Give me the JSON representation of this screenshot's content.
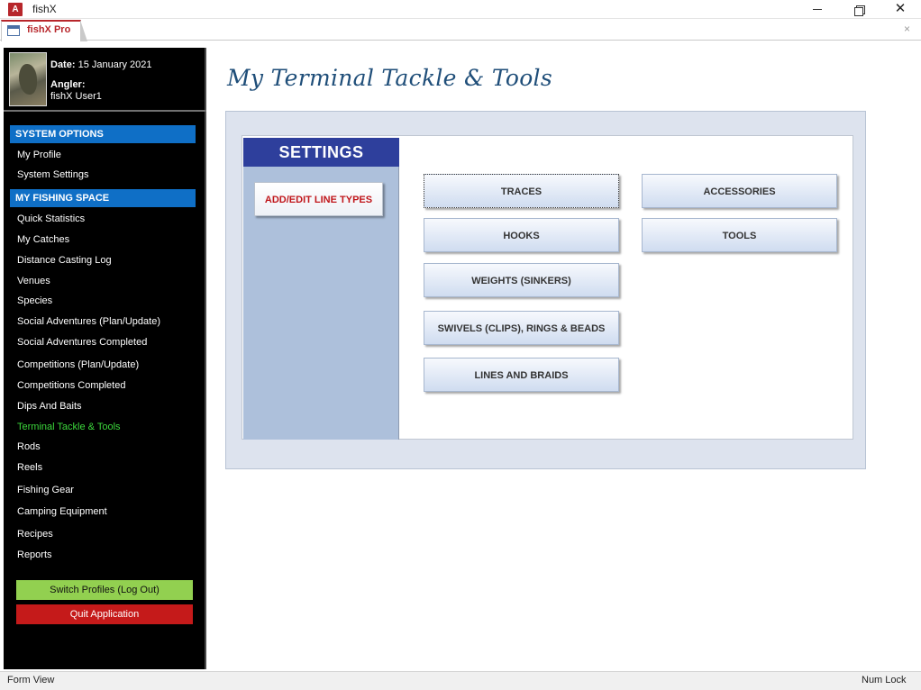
{
  "window": {
    "app_icon": "A",
    "title": "fishX",
    "min_label": "",
    "max_label": "",
    "close_label": "✕"
  },
  "tab": {
    "label": "fishX Pro",
    "close": "×"
  },
  "profile": {
    "date_label": "Date:",
    "date_value": "15 January 2021",
    "angler_label": "Angler:",
    "user": "fishX User1"
  },
  "sidebar": {
    "system_header": "SYSTEM OPTIONS",
    "system_items": [
      "My Profile",
      "System Settings"
    ],
    "fishing_header": "MY FISHING SPACE",
    "fishing_items": [
      "Quick Statistics",
      "My Catches",
      "Distance Casting Log",
      "Venues",
      "Species",
      "Social Adventures (Plan/Update)",
      "Social Adventures Completed",
      "Competitions (Plan/Update)",
      "Competitions Completed",
      "Dips And Baits",
      "Terminal Tackle & Tools",
      "Rods",
      "Reels",
      "Fishing Gear",
      "Camping Equipment",
      "Recipes",
      "Reports"
    ],
    "switch_label": "Switch Profiles (Log Out)",
    "quit_label": "Quit Application"
  },
  "main": {
    "title": "My Terminal Tackle & Tools",
    "settings_header": "SETTINGS",
    "add_line_label": "ADD/EDIT LINE TYPES",
    "buttons": {
      "traces": "TRACES",
      "hooks": "HOOKS",
      "weights": "WEIGHTS (SINKERS)",
      "swivels": "SWIVELS (CLIPS), RINGS & BEADS",
      "lines": "LINES AND BRAIDS",
      "accessories": "ACCESSORIES",
      "tools": "TOOLS"
    }
  },
  "status": {
    "left": "Form View",
    "right": "Num Lock"
  }
}
